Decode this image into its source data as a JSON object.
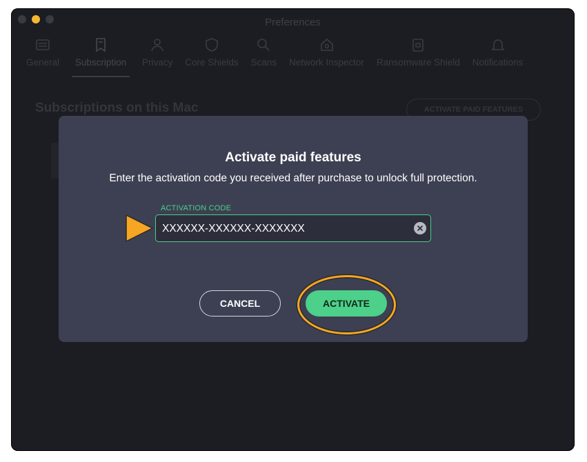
{
  "window": {
    "title": "Preferences"
  },
  "tabs": [
    {
      "label": "General",
      "icon": "general-icon"
    },
    {
      "label": "Subscription",
      "icon": "subscription-icon",
      "active": true
    },
    {
      "label": "Privacy",
      "icon": "privacy-icon"
    },
    {
      "label": "Core Shields",
      "icon": "shield-icon"
    },
    {
      "label": "Scans",
      "icon": "scan-icon"
    },
    {
      "label": "Network Inspector",
      "icon": "network-icon"
    },
    {
      "label": "Ransomware Shield",
      "icon": "ransomware-icon"
    },
    {
      "label": "Notifications",
      "icon": "bell-icon"
    }
  ],
  "background": {
    "section_title": "Subscriptions on this Mac",
    "activate_paid_features_label": "ACTIVATE PAID FEATURES"
  },
  "dialog": {
    "title": "Activate paid features",
    "description": "Enter the activation code you received after purchase to unlock full protection.",
    "field_label": "ACTIVATION CODE",
    "field_value": "XXXXXX-XXXXXX-XXXXXXX",
    "cancel_label": "CANCEL",
    "activate_label": "ACTIVATE"
  },
  "colors": {
    "accent": "#4cd08a",
    "highlight": "#f6a623",
    "dialog_bg": "#3d4052",
    "window_bg": "#1c1d22"
  }
}
